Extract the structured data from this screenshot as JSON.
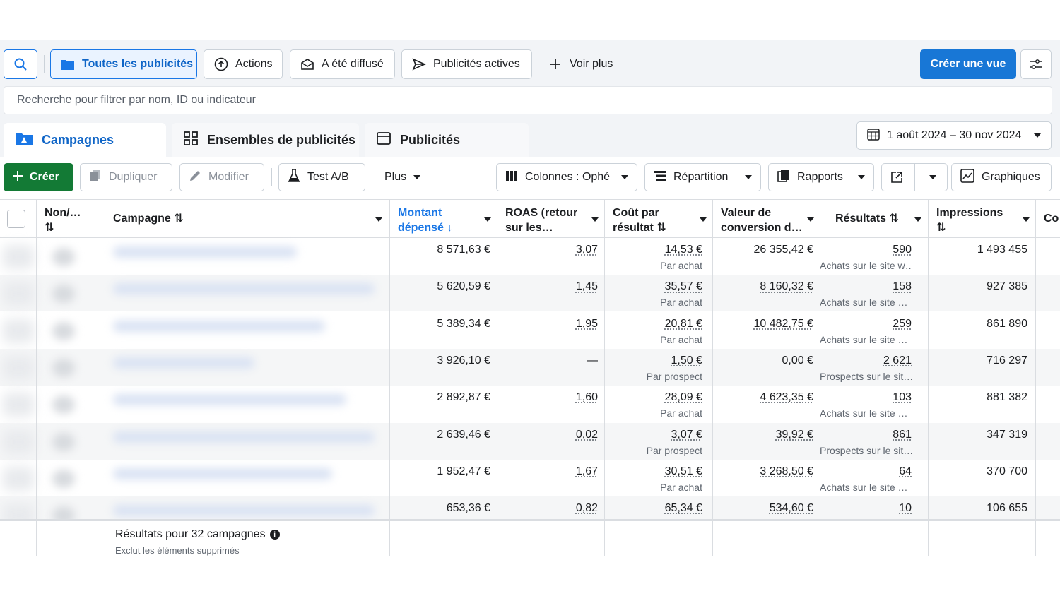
{
  "toolbar": {
    "filters": [
      {
        "label": "Toutes les publicités",
        "icon": "folder-icon"
      },
      {
        "label": "Actions",
        "icon": "upload-icon"
      },
      {
        "label": "A été diffusé",
        "icon": "envelope-icon"
      },
      {
        "label": "Publicités actives",
        "icon": "send-icon"
      },
      {
        "label": "Voir plus",
        "icon": "plus-icon"
      }
    ],
    "create_view_label": "Créer une vue"
  },
  "search": {
    "placeholder": "Recherche pour filtrer par nom, ID ou indicateur"
  },
  "tabs": [
    {
      "label": "Campagnes",
      "icon": "campaign-folder-icon"
    },
    {
      "label": "Ensembles de publicités",
      "icon": "grid-icon"
    },
    {
      "label": "Publicités",
      "icon": "ad-window-icon"
    }
  ],
  "date_range": "1 août 2024 – 30 nov 2024",
  "actions": {
    "create": "Créer",
    "duplicate": "Dupliquer",
    "edit": "Modifier",
    "ab_test": "Test A/B",
    "more": "Plus",
    "columns": "Colonnes : Ophé",
    "breakdown": "Répartition",
    "reports": "Rapports",
    "charts": "Graphiques"
  },
  "columns": {
    "onoff": "Non/…",
    "campaign": "Campagne",
    "spent": [
      "Montant",
      "dépensé"
    ],
    "roas": [
      "ROAS (retour",
      "sur les…"
    ],
    "cpr": [
      "Coût par",
      "résultat"
    ],
    "conv": [
      "Valeur de",
      "conversion d…"
    ],
    "results": "Résultats",
    "impressions": "Impressions",
    "next": "Co"
  },
  "rows": [
    {
      "spent": "8 571,63 €",
      "roas": "3,07",
      "cpr": "14,53 €",
      "cpr_sub": "Par achat",
      "conv": "26 355,42 €",
      "results": "590",
      "results_sub": "Achats sur le site w…",
      "impressions": "1 493 455"
    },
    {
      "spent": "5 620,59 €",
      "roas": "1,45",
      "cpr": "35,57 €",
      "cpr_sub": "Par achat",
      "conv": "8 160,32 €",
      "results": "158",
      "results_sub": "Achats sur le site …",
      "impressions": "927 385"
    },
    {
      "spent": "5 389,34 €",
      "roas": "1,95",
      "cpr": "20,81 €",
      "cpr_sub": "Par achat",
      "conv": "10 482,75 €",
      "results": "259",
      "results_sub": "Achats sur le site …",
      "impressions": "861 890"
    },
    {
      "spent": "3 926,10 €",
      "roas": "—",
      "cpr": "1,50 €",
      "cpr_sub": "Par prospect",
      "conv": "0,00 €",
      "results": "2 621",
      "results_sub": "Prospects sur le sit…",
      "impressions": "716 297"
    },
    {
      "spent": "2 892,87 €",
      "roas": "1,60",
      "cpr": "28,09 €",
      "cpr_sub": "Par achat",
      "conv": "4 623,35 €",
      "results": "103",
      "results_sub": "Achats sur le site …",
      "impressions": "881 382"
    },
    {
      "spent": "2 639,46 €",
      "roas": "0,02",
      "cpr": "3,07 €",
      "cpr_sub": "Par prospect",
      "conv": "39,92 €",
      "results": "861",
      "results_sub": "Prospects sur le sit…",
      "impressions": "347 319"
    },
    {
      "spent": "1 952,47 €",
      "roas": "1,67",
      "cpr": "30,51 €",
      "cpr_sub": "Par achat",
      "conv": "3 268,50 €",
      "results": "64",
      "results_sub": "Achats sur le site …",
      "impressions": "370 700"
    },
    {
      "spent": "653,36 €",
      "roas": "0,82",
      "cpr": "65,34 €",
      "cpr_sub": "",
      "conv": "534,60 €",
      "results": "10",
      "results_sub": "",
      "impressions": "106 655"
    }
  ],
  "footer": {
    "title": "Résultats pour 32 campagnes",
    "subtitle": "Exclut les éléments supprimés"
  },
  "colors": {
    "accent": "#1877d6",
    "create": "#137a35"
  }
}
